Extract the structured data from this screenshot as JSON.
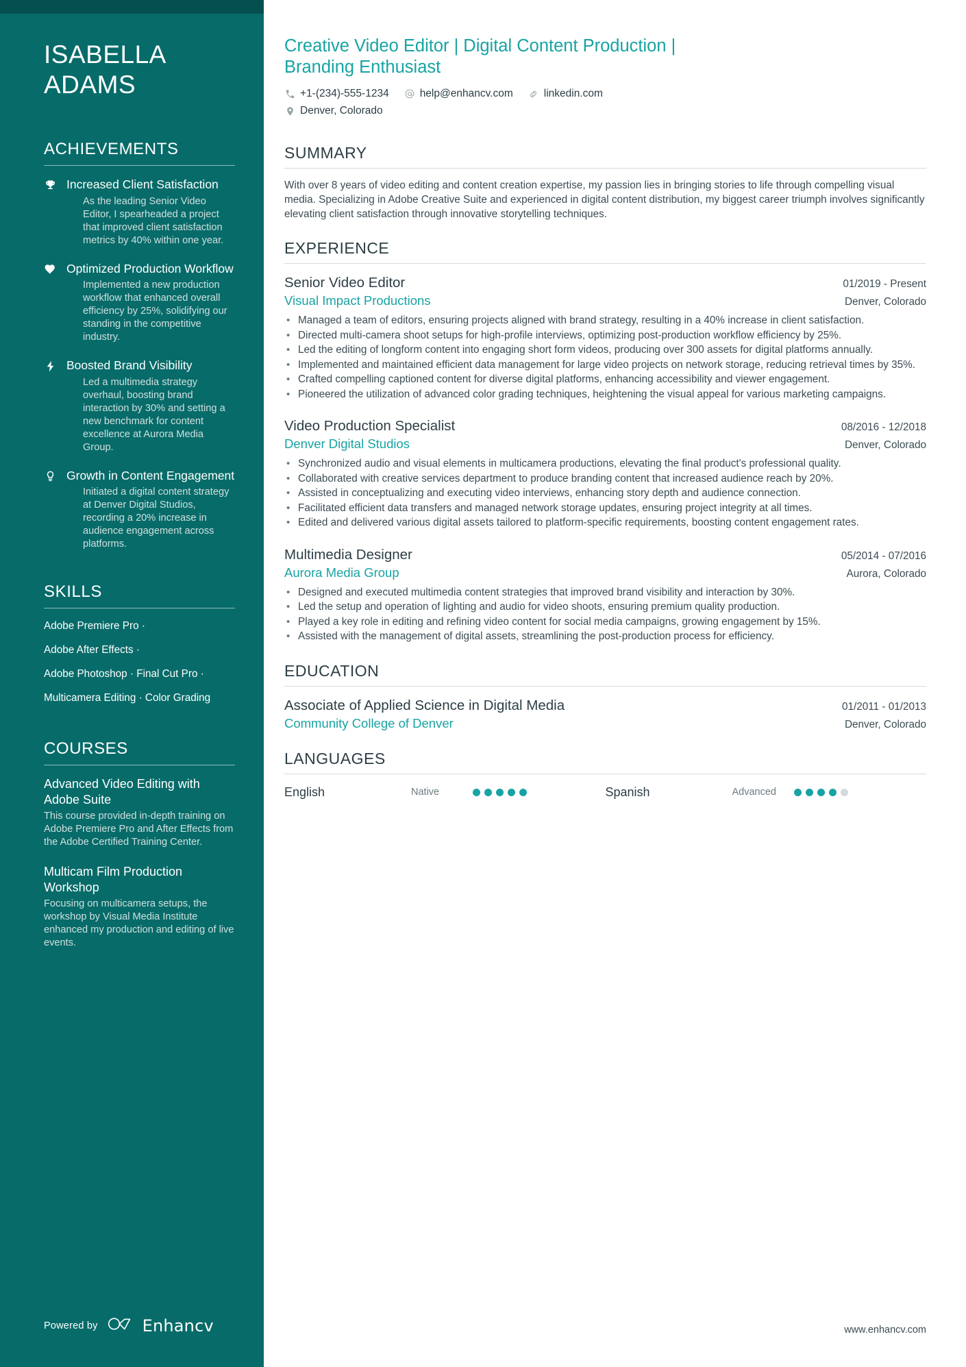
{
  "sidebar": {
    "name": "ISABELLA\nADAMS",
    "achievements": {
      "heading": "ACHIEVEMENTS",
      "items": [
        {
          "icon": "trophy-icon",
          "title": "Increased Client Satisfaction",
          "desc": "As the leading Senior Video Editor, I spearheaded a project that improved client satisfaction metrics by 40% within one year."
        },
        {
          "icon": "heart-icon",
          "title": "Optimized Production Workflow",
          "desc": "Implemented a new production workflow that enhanced overall efficiency by 25%, solidifying our standing in the competitive industry."
        },
        {
          "icon": "lightning-bolt-icon",
          "title": "Boosted Brand Visibility",
          "desc": "Led a multimedia strategy overhaul, boosting brand interaction by 30% and setting a new benchmark for content excellence at Aurora Media Group."
        },
        {
          "icon": "lightbulb-icon",
          "title": "Growth in Content Engagement",
          "desc": "Initiated a digital content strategy at Denver Digital Studios, recording a 20% increase in audience engagement across platforms."
        }
      ]
    },
    "skills": {
      "heading": "SKILLS",
      "lines": [
        "Adobe Premiere Pro ·",
        "Adobe After Effects ·",
        "Adobe Photoshop · Final Cut Pro ·",
        "Multicamera Editing · Color Grading"
      ]
    },
    "courses": {
      "heading": "COURSES",
      "items": [
        {
          "title": "Advanced Video Editing with Adobe Suite",
          "desc": "This course provided in-depth training on Adobe Premiere Pro and After Effects from the Adobe Certified Training Center."
        },
        {
          "title": "Multicam Film Production Workshop",
          "desc": "Focusing on multicamera setups, the workshop by Visual Media Institute enhanced my production and editing of live events."
        }
      ]
    },
    "footer": {
      "powered_by": "Powered by",
      "brand": "Enhancv"
    }
  },
  "main": {
    "headline": "Creative Video Editor | Digital Content Production | Branding Enthusiast",
    "contacts": [
      {
        "icon": "phone-icon",
        "text": "+1-(234)-555-1234"
      },
      {
        "icon": "at-sign-icon",
        "text": "help@enhancv.com"
      },
      {
        "icon": "link-icon",
        "text": "linkedin.com"
      }
    ],
    "contacts_row2": [
      {
        "icon": "map-pin-icon",
        "text": "Denver, Colorado"
      }
    ],
    "summary": {
      "heading": "SUMMARY",
      "text": "With over 8 years of video editing and content creation expertise, my passion lies in bringing stories to life through compelling visual media. Specializing in Adobe Creative Suite and experienced in digital content distribution, my biggest career triumph involves significantly elevating client satisfaction through innovative storytelling techniques."
    },
    "experience": {
      "heading": "EXPERIENCE",
      "jobs": [
        {
          "title": "Senior Video Editor",
          "date": "01/2019 - Present",
          "company": "Visual Impact Productions",
          "location": "Denver, Colorado",
          "bullets": [
            "Managed a team of editors, ensuring projects aligned with brand strategy, resulting in a 40% increase in client satisfaction.",
            "Directed multi-camera shoot setups for high-profile interviews, optimizing post-production workflow efficiency by 25%.",
            "Led the editing of longform content into engaging short form videos, producing over 300 assets for digital platforms annually.",
            "Implemented and maintained efficient data management for large video projects on network storage, reducing retrieval times by 35%.",
            "Crafted compelling captioned content for diverse digital platforms, enhancing accessibility and viewer engagement.",
            "Pioneered the utilization of advanced color grading techniques, heightening the visual appeal for various marketing campaigns."
          ]
        },
        {
          "title": "Video Production Specialist",
          "date": "08/2016 - 12/2018",
          "company": "Denver Digital Studios",
          "location": "Denver, Colorado",
          "bullets": [
            "Synchronized audio and visual elements in multicamera productions, elevating the final product's professional quality.",
            "Collaborated with creative services department to produce branding content that increased audience reach by 20%.",
            "Assisted in conceptualizing and executing video interviews, enhancing story depth and audience connection.",
            "Facilitated efficient data transfers and managed network storage updates, ensuring project integrity at all times.",
            "Edited and delivered various digital assets tailored to platform-specific requirements, boosting content engagement rates."
          ]
        },
        {
          "title": "Multimedia Designer",
          "date": "05/2014 - 07/2016",
          "company": "Aurora Media Group",
          "location": "Aurora, Colorado",
          "bullets": [
            "Designed and executed multimedia content strategies that improved brand visibility and interaction by 30%.",
            "Led the setup and operation of lighting and audio for video shoots, ensuring premium quality production.",
            "Played a key role in editing and refining video content for social media campaigns, growing engagement by 15%.",
            "Assisted with the management of digital assets, streamlining the post-production process for efficiency."
          ]
        }
      ]
    },
    "education": {
      "heading": "EDUCATION",
      "items": [
        {
          "degree": "Associate of Applied Science in Digital Media",
          "date": "01/2011 - 01/2013",
          "school": "Community College of Denver",
          "location": "Denver, Colorado"
        }
      ]
    },
    "languages": {
      "heading": "LANGUAGES",
      "items": [
        {
          "name": "English",
          "level": "Native",
          "filled": 5,
          "total": 5
        },
        {
          "name": "Spanish",
          "level": "Advanced",
          "filled": 4,
          "total": 5
        }
      ]
    },
    "footer_url": "www.enhancv.com"
  },
  "colors": {
    "sidebar_bg": "#076b69",
    "sidebar_topbar": "#04504f",
    "accent_teal": "#18a3a3",
    "text_dark": "#2c3e45",
    "muted": "#6b7a80"
  }
}
